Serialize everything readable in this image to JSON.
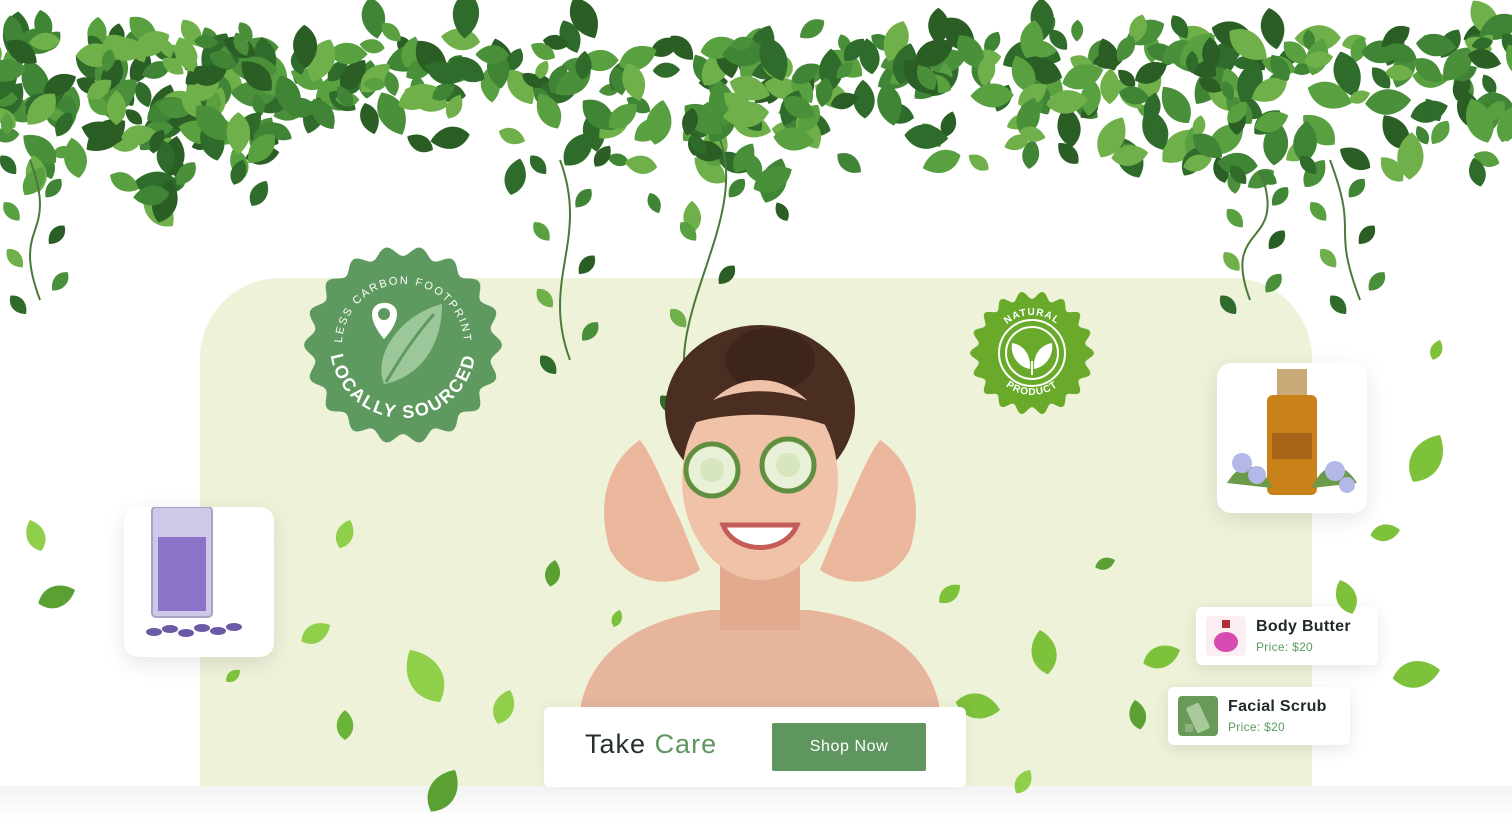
{
  "badges": {
    "locally_sourced": {
      "ring_text": "LESS CARBON FOOTPRINT",
      "main_text": "LOCALLY SOURCED",
      "icon": "leaf-pin-icon"
    },
    "natural_product": {
      "top_text": "NATURAL",
      "bottom_text": "PRODUCT",
      "icon": "sprout-icon"
    }
  },
  "products": [
    {
      "name": "Body Butter",
      "price": "Price: $20",
      "icon": "perfume-bottle-icon"
    },
    {
      "name": "Facial Scrub",
      "price": "Price: $20",
      "icon": "tube-icon"
    }
  ],
  "cta": {
    "title_part1": "Take",
    "title_part2": "Care",
    "button_label": "Shop Now"
  },
  "colors": {
    "accent_green": "#5f955f",
    "panel_bg": "#eef2d9",
    "badge_green_dark": "#5e9a5f",
    "badge_green_bright": "#6aaa2a"
  }
}
